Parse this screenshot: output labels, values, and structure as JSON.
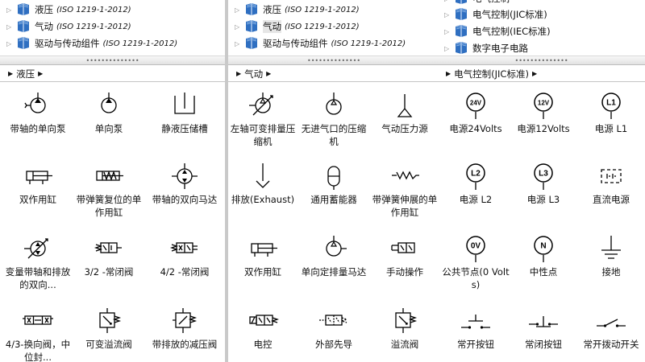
{
  "panels": [
    {
      "tree": [
        {
          "label": "液压",
          "std": "(ISO 1219-1-2012)",
          "selected": false
        },
        {
          "label": "气动",
          "std": "(ISO 1219-1-2012)",
          "selected": false
        },
        {
          "label": "驱动与传动组件",
          "std": "(ISO 1219-1-2012)",
          "selected": false
        }
      ],
      "breadcrumb": "液压",
      "symbols": [
        {
          "label": "带轴的单向泵",
          "icon": "pump-shaft-icon"
        },
        {
          "label": "单向泵",
          "icon": "pump-icon"
        },
        {
          "label": "静液压储槽",
          "icon": "reservoir-icon"
        },
        {
          "label": "双作用缸",
          "icon": "double-cylinder-icon"
        },
        {
          "label": "带弹簧复位的单作用缸",
          "icon": "spring-cylinder-icon"
        },
        {
          "label": "带轴的双向马达",
          "icon": "bidirectional-motor-icon"
        },
        {
          "label": "变量带轴和排放的双向...",
          "icon": "variable-motor-icon"
        },
        {
          "label": "3/2 -常闭阀",
          "icon": "valve-32-icon"
        },
        {
          "label": "4/2 -常闭阀",
          "icon": "valve-42-icon"
        },
        {
          "label": "4/3-换向阀，中位封...",
          "icon": "valve-43-icon"
        },
        {
          "label": "可变溢流阀",
          "icon": "relief-valve-icon"
        },
        {
          "label": "带排放的减压阀",
          "icon": "reducing-valve-icon"
        }
      ]
    },
    {
      "tree": [
        {
          "label": "液压",
          "std": "(ISO 1219-1-2012)",
          "selected": false
        },
        {
          "label": "气动",
          "std": "(ISO 1219-1-2012)",
          "selected": true
        },
        {
          "label": "驱动与传动组件",
          "std": "(ISO 1219-1-2012)",
          "selected": false
        }
      ],
      "breadcrumb": "气动",
      "symbols": [
        {
          "label": "左轴可变排量压缩机",
          "icon": "variable-compressor-icon"
        },
        {
          "label": "无进气口的压缩机",
          "icon": "compressor-icon"
        },
        {
          "label": "气动压力源",
          "icon": "pressure-source-icon"
        },
        {
          "label": "排放(Exhaust)",
          "icon": "exhaust-icon"
        },
        {
          "label": "通用蓄能器",
          "icon": "accumulator-icon"
        },
        {
          "label": "带弹簧伸展的单作用缸",
          "icon": "spring-extend-cylinder-icon"
        },
        {
          "label": "双作用缸",
          "icon": "double-cylinder-icon"
        },
        {
          "label": "单向定排量马达",
          "icon": "fixed-motor-icon"
        },
        {
          "label": "手动操作",
          "icon": "manual-valve-icon"
        },
        {
          "label": "电控",
          "icon": "electric-valve-icon"
        },
        {
          "label": "外部先导",
          "icon": "pilot-valve-icon"
        },
        {
          "label": "溢流阀",
          "icon": "relief-valve-icon"
        }
      ]
    },
    {
      "tree": [
        {
          "label": "电气控制",
          "std": "",
          "selected": false
        },
        {
          "label": "电气控制(JIC标准)",
          "std": "",
          "selected": false
        },
        {
          "label": "电气控制(IEC标准)",
          "std": "",
          "selected": false
        },
        {
          "label": "数字电子电路",
          "std": "",
          "selected": false
        }
      ],
      "breadcrumb": "电气控制(JIC标准)",
      "symbols": [
        {
          "label": "电源24Volts",
          "icon": "source-24v-icon",
          "tag": "24V"
        },
        {
          "label": "电源12Volts",
          "icon": "source-12v-icon",
          "tag": "12V"
        },
        {
          "label": "电源 L1",
          "icon": "source-l1-icon",
          "tag": "L1"
        },
        {
          "label": "电源 L2",
          "icon": "source-l2-icon",
          "tag": "L2"
        },
        {
          "label": "电源 L3",
          "icon": "source-l3-icon",
          "tag": "L3"
        },
        {
          "label": "直流电源",
          "icon": "dc-source-icon",
          "tag": ""
        },
        {
          "label": "公共节点(0 Volts)",
          "icon": "common-node-icon",
          "tag": "0V"
        },
        {
          "label": "中性点",
          "icon": "neutral-icon",
          "tag": "N"
        },
        {
          "label": "接地",
          "icon": "ground-icon",
          "tag": ""
        },
        {
          "label": "常开按钮",
          "icon": "no-button-icon",
          "tag": ""
        },
        {
          "label": "常闭按钮",
          "icon": "nc-button-icon",
          "tag": ""
        },
        {
          "label": "常开拨动开关",
          "icon": "toggle-switch-icon",
          "tag": ""
        }
      ]
    }
  ]
}
